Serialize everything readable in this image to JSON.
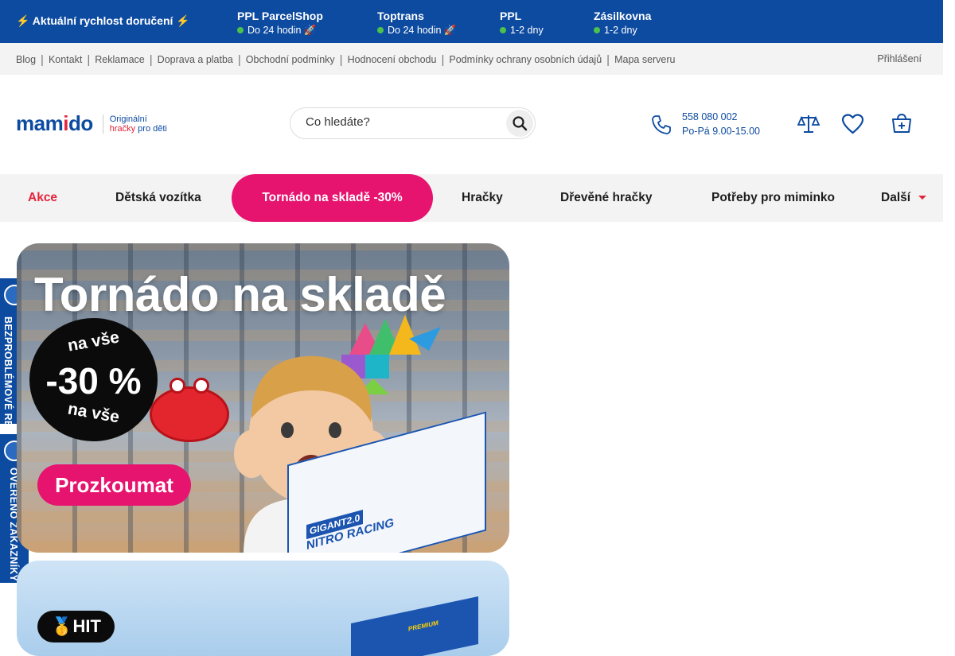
{
  "topbar": {
    "promo": "⚡ Aktuální rychlost doručení ⚡",
    "carriers": [
      {
        "name": "PPL ParcelShop",
        "time": "Do 24 hodin 🚀"
      },
      {
        "name": "Toptrans",
        "time": "Do 24 hodin 🚀"
      },
      {
        "name": "PPL",
        "time": "1-2 dny"
      },
      {
        "name": "Zásilkovna",
        "time": "1-2 dny"
      }
    ]
  },
  "linkbar": {
    "links": [
      "Blog",
      "Kontakt",
      "Reklamace",
      "Doprava a platba",
      "Obchodní podmínky",
      "Hodnocení obchodu",
      "Podmínky ochrany osobních údajů",
      "Mapa serveru"
    ],
    "login": "Přihlášení"
  },
  "header": {
    "logo_text": "mamido",
    "tagline_line1": "Originální",
    "tagline_line2a": "hračky",
    "tagline_line2b": " pro děti",
    "search_placeholder": "Co hledáte?",
    "phone": "558 080 002",
    "hours": "Po-Pá 9.00-15.00",
    "icons": [
      "compare-icon",
      "heart-icon",
      "cart-icon"
    ]
  },
  "nav": {
    "items": [
      "Akce",
      "Dětská vozítka",
      "Tornádo na skladě -30%",
      "Hračky",
      "Dřevěné hračky",
      "Potřeby pro miminko",
      "Další"
    ]
  },
  "side": {
    "badge1": "BEZPROBLÉMOVÉ REKLAMACE",
    "badge2": "OVĚŘENO ZÁKAZNÍKY"
  },
  "banner1": {
    "headline": "Tornádo na skladě",
    "disc_top": "na vše",
    "disc_pct": "-30 %",
    "disc_bottom": "na vše",
    "cta": "Prozkoumat",
    "box_line1": "GIGANT2.0",
    "box_line2": "NITRO RACING"
  },
  "banner2": {
    "hit": "🥇HIT",
    "box_label": "PREMIUM"
  },
  "colors": {
    "brand_blue": "#0d4ba1",
    "accent_pink": "#e6136f",
    "sale_red": "#e4243c",
    "ok_green": "#4cc24c"
  }
}
